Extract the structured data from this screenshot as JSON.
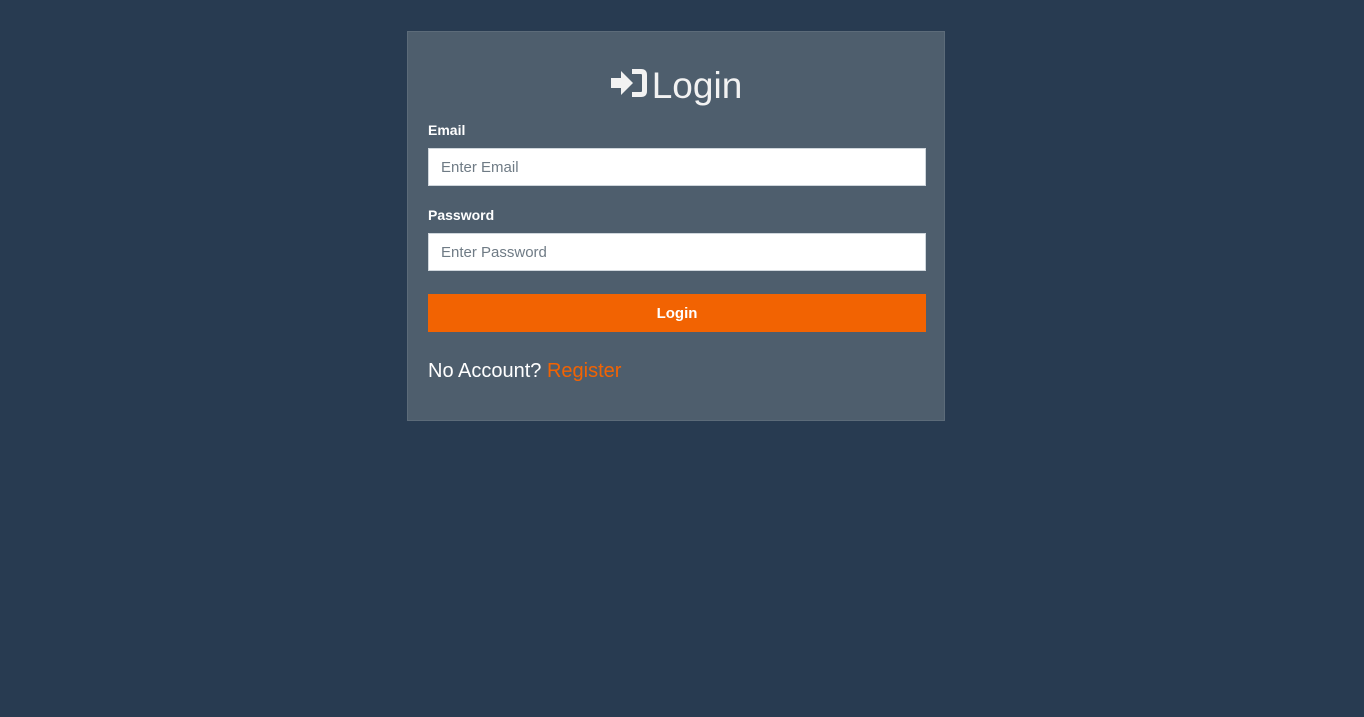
{
  "login": {
    "title": "Login",
    "email_label": "Email",
    "email_placeholder": "Enter Email",
    "email_value": "",
    "password_label": "Password",
    "password_placeholder": "Enter Password",
    "password_value": "",
    "submit_label": "Login",
    "no_account_text": "No Account?",
    "register_link": "Register"
  },
  "icons": {
    "title_icon": "sign-in-icon"
  },
  "colors": {
    "background": "#283b51",
    "card": "#4e5e6d",
    "accent": "#f26302"
  }
}
